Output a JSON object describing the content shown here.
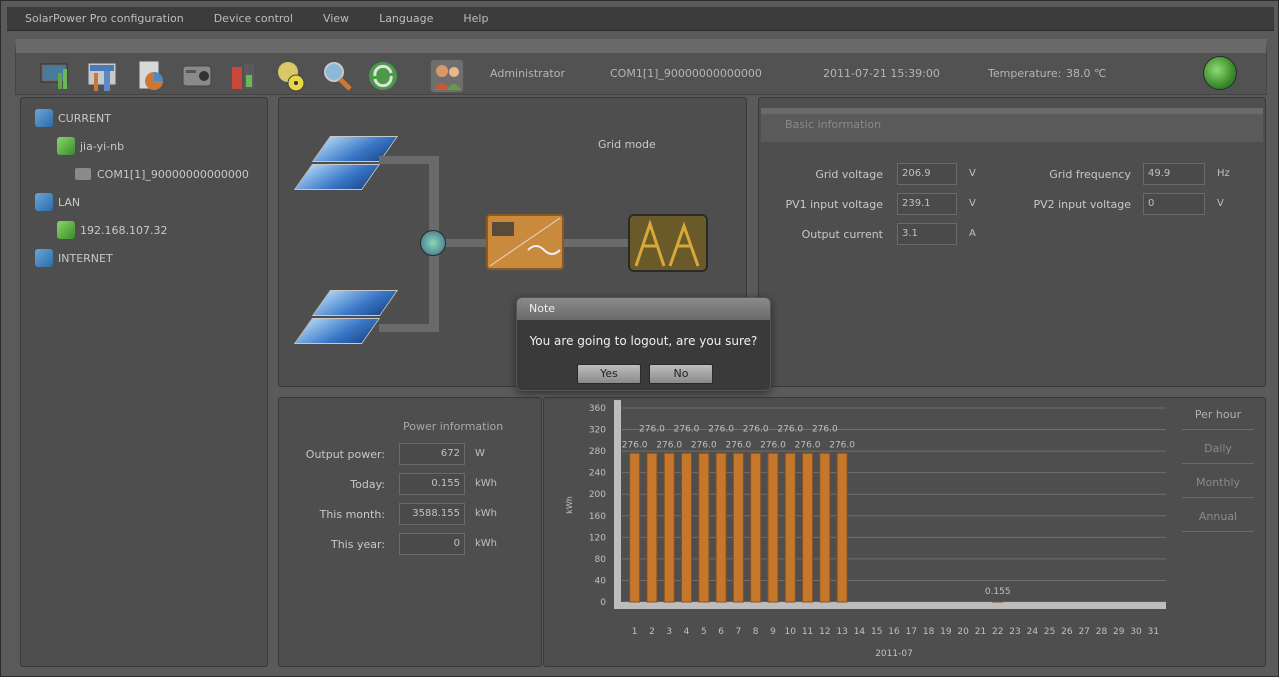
{
  "menubar": {
    "items": [
      "SolarPower Pro configuration",
      "Device control",
      "View",
      "Language",
      "Help"
    ]
  },
  "toolbar": {
    "tools": [
      "monitor-chart-icon",
      "settings-tools-icon",
      "report-pie-icon",
      "device-icon",
      "battery-icon",
      "warning-radiation-icon",
      "search-icon",
      "refresh-icon",
      "users-icon"
    ],
    "user": "Administrator",
    "port": "COM1[1]_90000000000000",
    "datetime": "2011-07-21 15:39:00",
    "temperature_label": "Temperature:",
    "temperature_value": "38.0 ℃"
  },
  "tree": {
    "current": "CURRENT",
    "node": "jia-yi-nb",
    "port": "COM1[1]_90000000000000",
    "lan": "LAN",
    "lan_ip": "192.168.107.32",
    "internet": "INTERNET"
  },
  "diagram": {
    "mode": "Grid mode"
  },
  "basic": {
    "title": "Basic information",
    "grid_voltage_label": "Grid voltage",
    "grid_voltage": "206.9",
    "grid_voltage_unit": "V",
    "pv1_label": "PV1 input voltage",
    "pv1": "239.1",
    "pv1_unit": "V",
    "output_current_label": "Output current",
    "output_current": "3.1",
    "output_current_unit": "A",
    "grid_freq_label": "Grid frequency",
    "grid_freq": "49.9",
    "grid_freq_unit": "Hz",
    "pv2_label": "PV2 input voltage",
    "pv2": "0",
    "pv2_unit": "V"
  },
  "power": {
    "title": "Power information",
    "output_label": "Output power:",
    "output": "672",
    "output_unit": "W",
    "today_label": "Today:",
    "today": "0.155",
    "today_unit": "kWh",
    "month_label": "This month:",
    "month": "3588.155",
    "month_unit": "kWh",
    "year_label": "This year:",
    "year": "0",
    "year_unit": "kWh"
  },
  "tabs": [
    "Per hour",
    "Daily",
    "Monthly",
    "Annual"
  ],
  "chart_data": {
    "type": "bar",
    "ylabel": "kWh",
    "xlabel": "2011-07",
    "ylim": [
      0,
      360
    ],
    "yticks": [
      0,
      40,
      80,
      120,
      160,
      200,
      240,
      280,
      320,
      360
    ],
    "categories": [
      "1",
      "2",
      "3",
      "4",
      "5",
      "6",
      "7",
      "8",
      "9",
      "10",
      "11",
      "12",
      "13",
      "14",
      "15",
      "16",
      "17",
      "18",
      "19",
      "20",
      "21",
      "22",
      "23",
      "24",
      "25",
      "26",
      "27",
      "28",
      "29",
      "30",
      "31"
    ],
    "values": [
      276,
      276,
      276,
      276,
      276,
      276,
      276,
      276,
      276,
      276,
      276,
      276,
      276,
      0,
      0,
      0,
      0,
      0,
      0,
      0,
      0,
      0.155,
      0,
      0,
      0,
      0,
      0,
      0,
      0,
      0,
      0
    ],
    "data_labels": [
      "276.0",
      "276.0",
      "276.0",
      "276.0",
      "276.0",
      "276.0",
      "276.0",
      "276.0",
      "276.0",
      "276.0",
      "276.0",
      "276.0",
      "276.0",
      "",
      "",
      "",
      "",
      "",
      "",
      "",
      "",
      "0.155",
      "",
      "",
      "",
      "",
      "",
      "",
      "",
      "",
      ""
    ],
    "grid": true,
    "bar_color": "#c5782c"
  },
  "dialog": {
    "title": "Note",
    "message": "You are going to logout, are you sure?",
    "yes": "Yes",
    "no": "No"
  }
}
